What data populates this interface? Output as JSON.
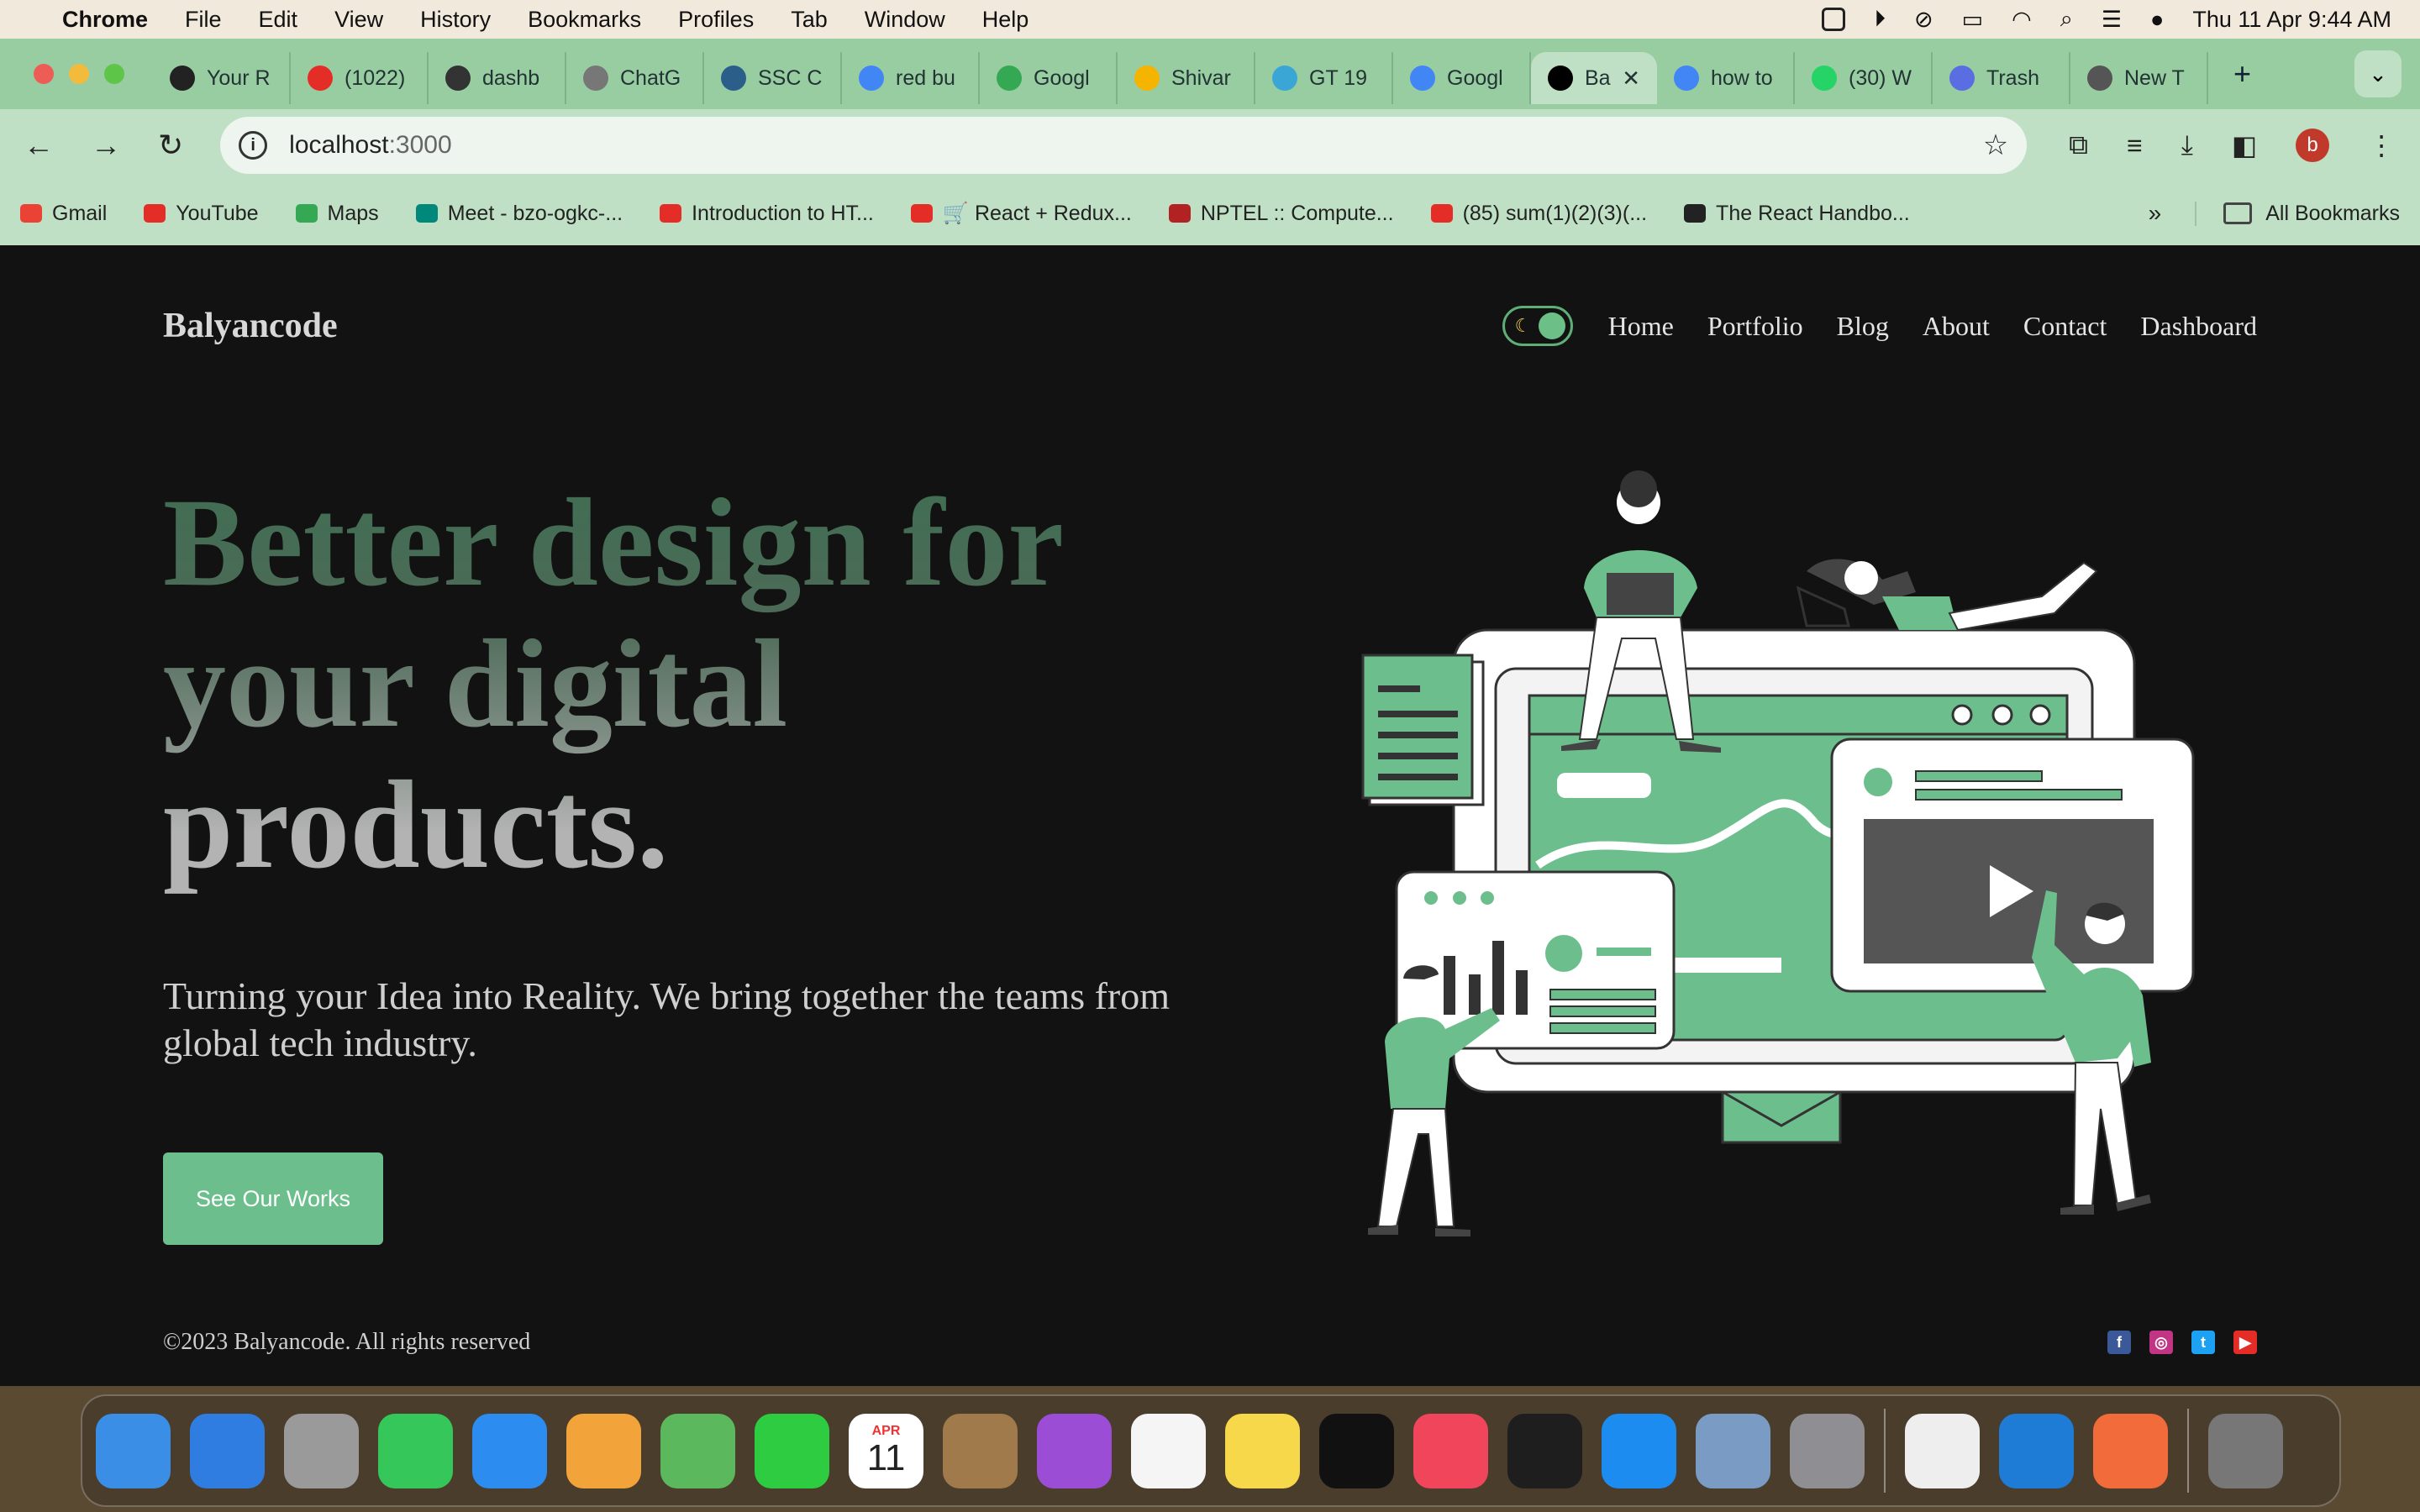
{
  "menubar": {
    "app": "Chrome",
    "items": [
      "File",
      "Edit",
      "View",
      "History",
      "Bookmarks",
      "Profiles",
      "Tab",
      "Window",
      "Help"
    ],
    "datetime": "Thu 11 Apr  9:44 AM"
  },
  "tabs": [
    {
      "label": "Your R",
      "color": "#222"
    },
    {
      "label": "(1022)",
      "color": "#e52d27"
    },
    {
      "label": "dashb",
      "color": "#333"
    },
    {
      "label": "ChatG",
      "color": "#777"
    },
    {
      "label": "SSC C",
      "color": "#2c5e8a"
    },
    {
      "label": "red bu",
      "color": "#4285f4"
    },
    {
      "label": "Googl",
      "color": "#34a853"
    },
    {
      "label": "Shivar",
      "color": "#f4b400"
    },
    {
      "label": "GT 19",
      "color": "#3aa6d6"
    },
    {
      "label": "Googl",
      "color": "#4285f4"
    },
    {
      "label": "Ba",
      "color": "#000"
    },
    {
      "label": "how to",
      "color": "#4285f4"
    },
    {
      "label": "(30) W",
      "color": "#25d366"
    },
    {
      "label": "Trash",
      "color": "#5b6ee1"
    },
    {
      "label": "New T",
      "color": "#555"
    }
  ],
  "toolbar": {
    "url_host": "localhost",
    "url_port": ":3000"
  },
  "bookmarks": [
    {
      "label": "Gmail",
      "color": "#ea4335"
    },
    {
      "label": "YouTube",
      "color": "#e52d27"
    },
    {
      "label": "Maps",
      "color": "#34a853"
    },
    {
      "label": "Meet - bzo-ogkc-...",
      "color": "#00897b"
    },
    {
      "label": "Introduction to HT...",
      "color": "#e52d27"
    },
    {
      "label": "🛒 React + Redux...",
      "color": "#e52d27"
    },
    {
      "label": "NPTEL :: Compute...",
      "color": "#b22222"
    },
    {
      "label": "(85) sum(1)(2)(3)(...",
      "color": "#e52d27"
    },
    {
      "label": "The React Handbo...",
      "color": "#222"
    }
  ],
  "all_bookmarks": "All Bookmarks",
  "site": {
    "brand": "Balyancode",
    "nav": [
      "Home",
      "Portfolio",
      "Blog",
      "About",
      "Contact",
      "Dashboard"
    ],
    "hero_title": "Better design for your digital products.",
    "hero_subtitle": "Turning your Idea into Reality. We bring together the teams from global tech industry.",
    "cta": "See Our Works",
    "footer": "©2023 Balyancode. All rights reserved",
    "accent": "#6cbf8c",
    "social": [
      {
        "name": "facebook-icon",
        "glyph": "f",
        "color": "#3b5998"
      },
      {
        "name": "instagram-icon",
        "glyph": "◎",
        "color": "#c13584"
      },
      {
        "name": "twitter-icon",
        "glyph": "t",
        "color": "#1da1f2"
      },
      {
        "name": "youtube-icon",
        "glyph": "▶",
        "color": "#e52d27"
      }
    ]
  },
  "dock": [
    {
      "name": "finder-icon",
      "color": "#3a8ee6"
    },
    {
      "name": "safari-icon",
      "color": "#2f7de1"
    },
    {
      "name": "launchpad-icon",
      "color": "#9a9a9a"
    },
    {
      "name": "messages-icon",
      "color": "#35c759"
    },
    {
      "name": "mail-icon",
      "color": "#2d8cf0"
    },
    {
      "name": "photos-icon",
      "color": "#f2a33a"
    },
    {
      "name": "maps-icon",
      "color": "#5cb85c"
    },
    {
      "name": "facetime-icon",
      "color": "#2ecc40"
    },
    {
      "name": "calendar-icon",
      "color": "#ffffff",
      "label_top": "APR",
      "label_day": "11"
    },
    {
      "name": "contacts-icon",
      "color": "#a07a4a"
    },
    {
      "name": "podcasts-icon",
      "color": "#9b4dd6"
    },
    {
      "name": "reminders-icon",
      "color": "#f5f5f5"
    },
    {
      "name": "notes-icon",
      "color": "#f7d84a"
    },
    {
      "name": "tv-icon",
      "color": "#111111"
    },
    {
      "name": "music-icon",
      "color": "#f0455a"
    },
    {
      "name": "terminal-icon",
      "color": "#1e1e1e"
    },
    {
      "name": "app-store-icon",
      "color": "#1d8cf0"
    },
    {
      "name": "preview-icon",
      "color": "#7a9cc4"
    },
    {
      "name": "system-settings-icon",
      "color": "#8e8e93"
    },
    {
      "name": "chrome-icon",
      "color": "#eeeeee"
    },
    {
      "name": "vscode-icon",
      "color": "#1e7bd6"
    },
    {
      "name": "pen-app-icon",
      "color": "#f26b3a"
    },
    {
      "name": "trash-icon",
      "color": "#777777"
    }
  ]
}
